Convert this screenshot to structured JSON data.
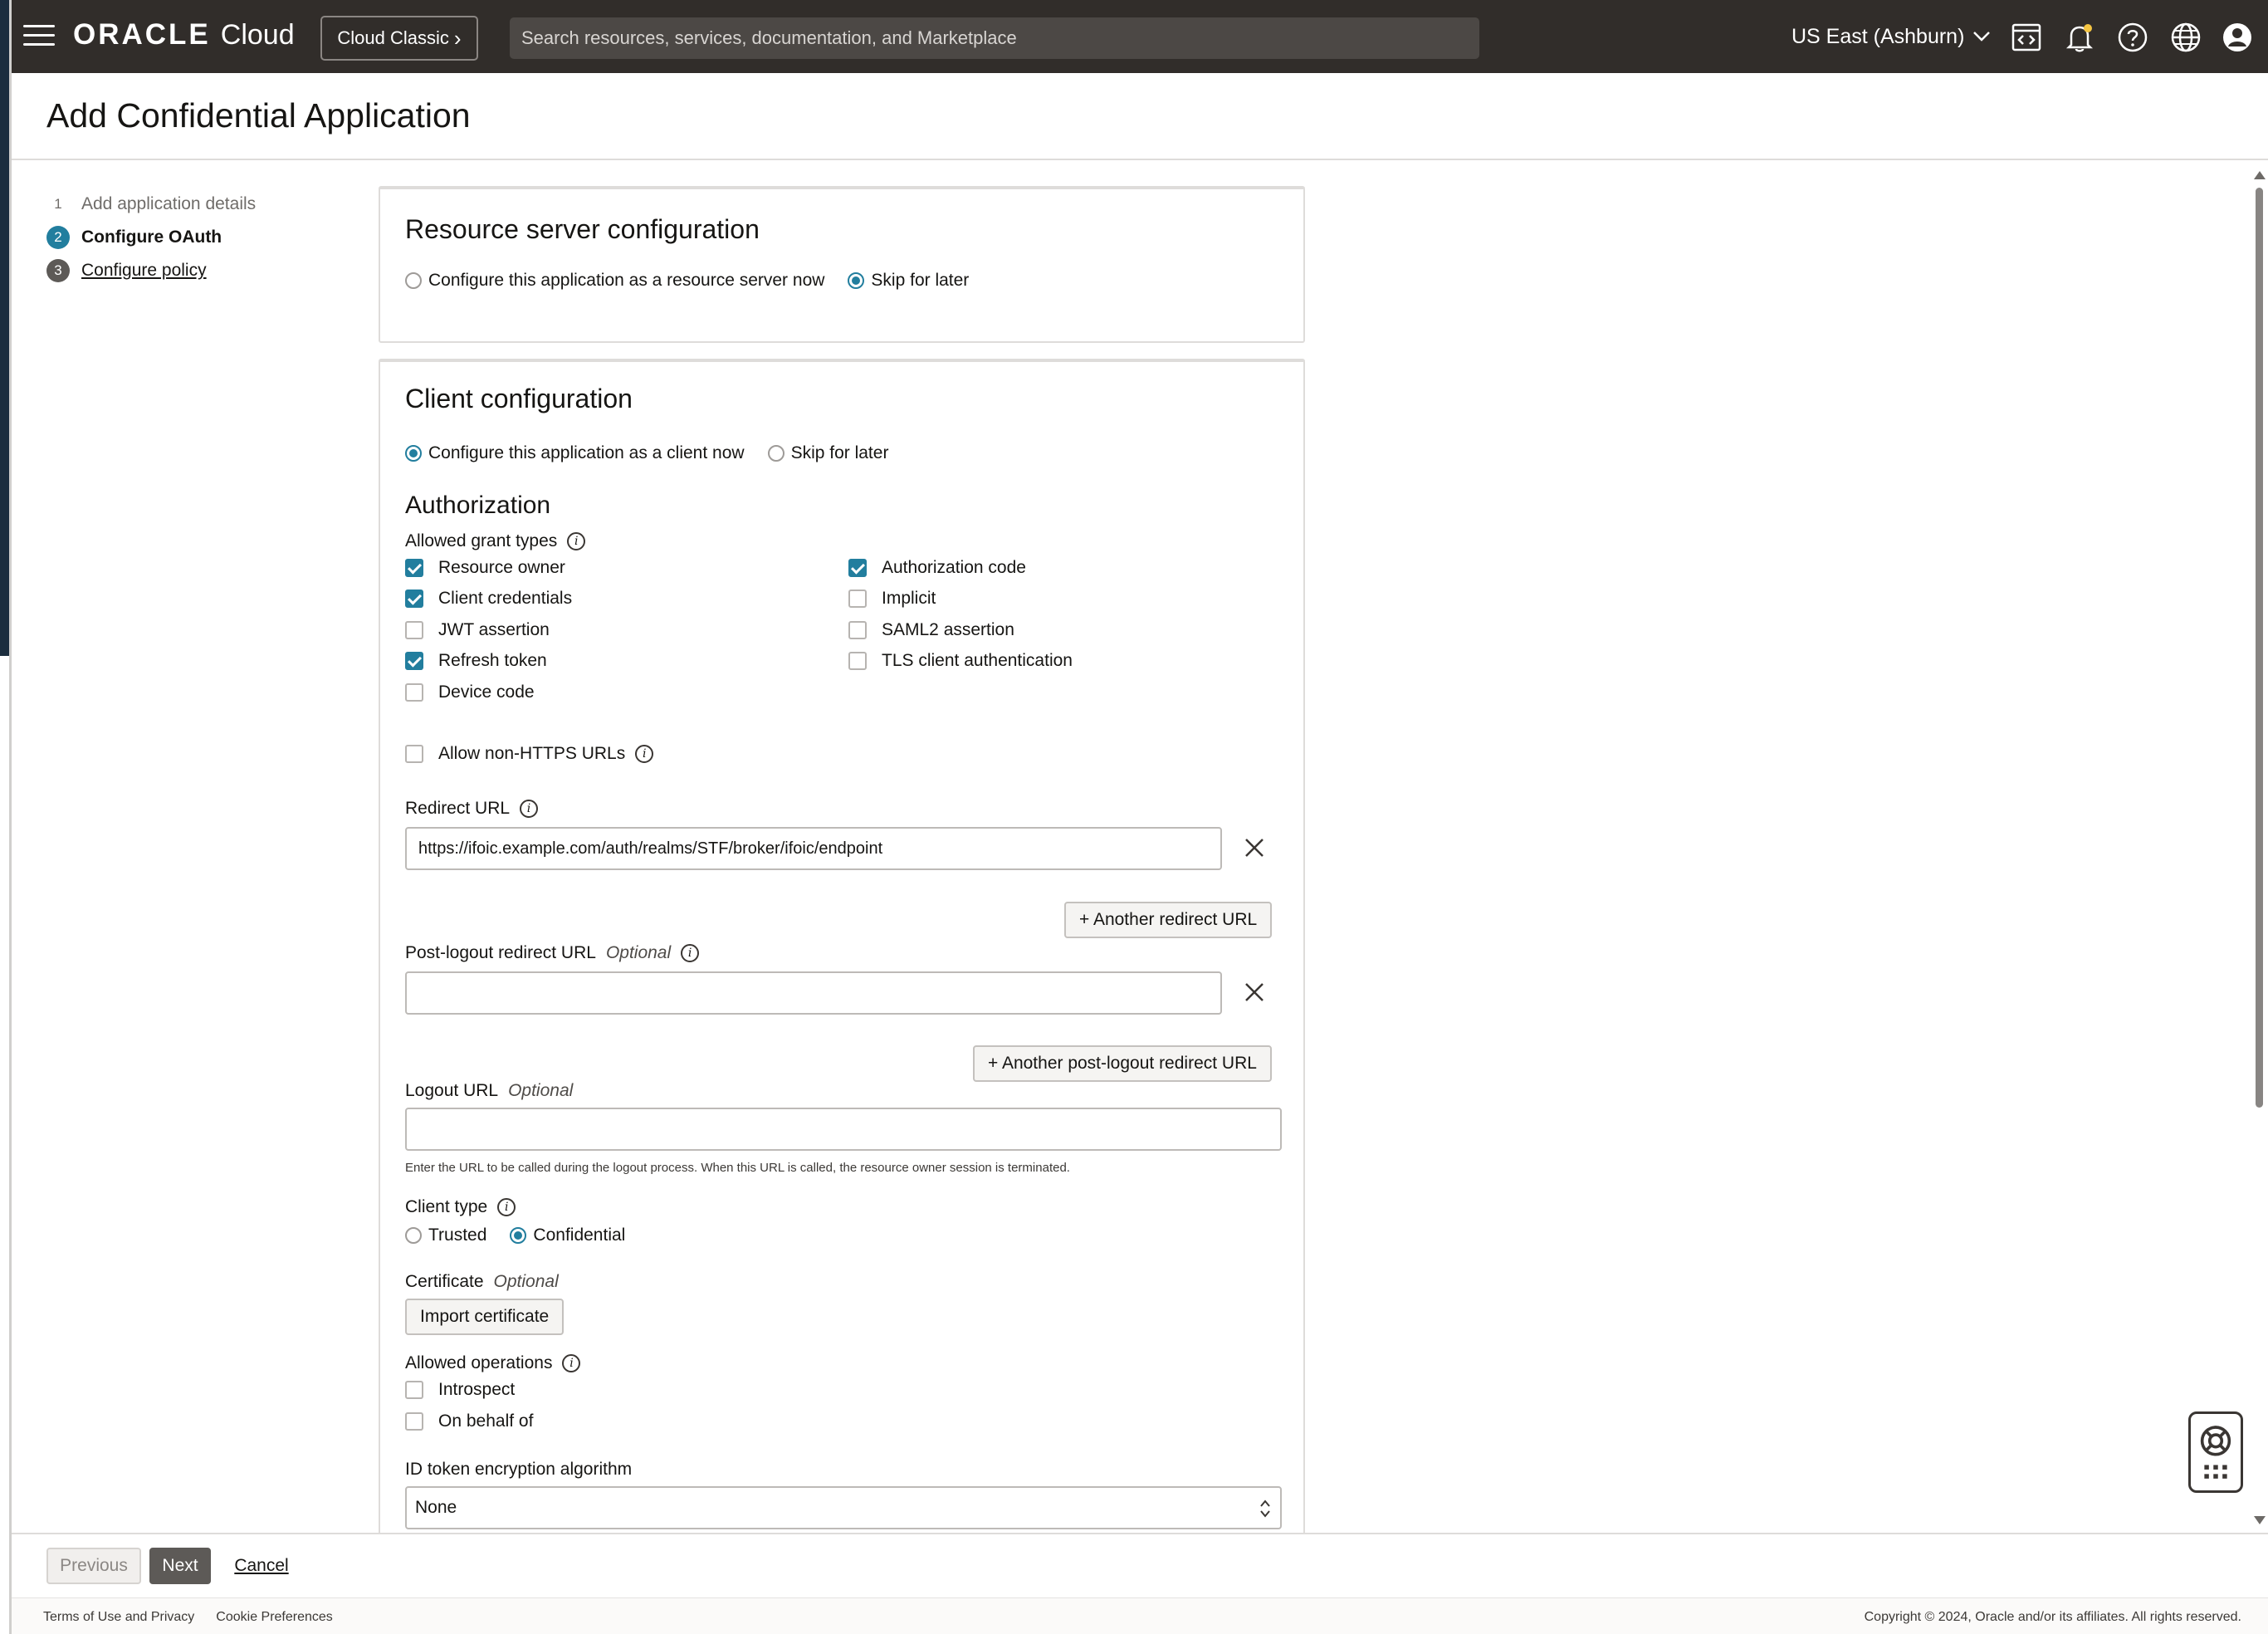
{
  "header": {
    "brand_oracle": "ORACLE",
    "brand_cloud": "Cloud",
    "classic_button": "Cloud Classic",
    "search_placeholder": "Search resources, services, documentation, and Marketplace",
    "region": "US East (Ashburn)",
    "icons": [
      "menu-icon",
      "code-editor-icon",
      "bell-icon",
      "help-icon",
      "globe-icon",
      "user-icon"
    ]
  },
  "page": {
    "title": "Add Confidential Application"
  },
  "steps": [
    {
      "num": "1",
      "label": "Add application details"
    },
    {
      "num": "2",
      "label": "Configure OAuth"
    },
    {
      "num": "3",
      "label": "Configure policy"
    }
  ],
  "resource_server": {
    "title": "Resource server configuration",
    "option_now": "Configure this application as a resource server now",
    "option_later": "Skip for later",
    "selected": "later"
  },
  "client_config": {
    "title": "Client configuration",
    "option_now": "Configure this application as a client now",
    "option_later": "Skip for later",
    "selected": "now",
    "authorization_title": "Authorization",
    "grant_types_label": "Allowed grant types",
    "grants_left": [
      {
        "label": "Resource owner",
        "checked": true
      },
      {
        "label": "Client credentials",
        "checked": true
      },
      {
        "label": "JWT assertion",
        "checked": false
      },
      {
        "label": "Refresh token",
        "checked": true
      },
      {
        "label": "Device code",
        "checked": false
      }
    ],
    "grants_right": [
      {
        "label": "Authorization code",
        "checked": true
      },
      {
        "label": "Implicit",
        "checked": false
      },
      {
        "label": "SAML2 assertion",
        "checked": false
      },
      {
        "label": "TLS client authentication",
        "checked": false
      }
    ],
    "allow_non_https": "Allow non-HTTPS URLs",
    "redirect_url_label": "Redirect URL",
    "redirect_url_value": "https://ifoic.example.com/auth/realms/STF/broker/ifoic/endpoint",
    "another_redirect": "+ Another redirect URL",
    "post_logout_label": "Post-logout redirect URL",
    "optional": "Optional",
    "another_post_logout": "+ Another post-logout redirect URL",
    "logout_url_label": "Logout URL",
    "logout_helper": "Enter the URL to be called during the logout process. When this URL is called, the resource owner session is terminated.",
    "client_type_label": "Client type",
    "client_type_trusted": "Trusted",
    "client_type_confidential": "Confidential",
    "client_type_selected": "confidential",
    "certificate_label": "Certificate",
    "import_certificate": "Import certificate",
    "allowed_operations_label": "Allowed operations",
    "operations": [
      {
        "label": "Introspect",
        "checked": false
      },
      {
        "label": "On behalf of",
        "checked": false
      }
    ],
    "id_token_label": "ID token encryption algorithm",
    "id_token_value": "None"
  },
  "footer_buttons": {
    "previous": "Previous",
    "next": "Next",
    "cancel": "Cancel"
  },
  "page_footer": {
    "terms": "Terms of Use and Privacy",
    "cookies": "Cookie Preferences",
    "copyright": "Copyright © 2024, Oracle and/or its affiliates. All rights reserved."
  },
  "colors": {
    "header_bg": "#312d2a",
    "accent": "#227e9e",
    "next_button": "#5d5a57"
  }
}
